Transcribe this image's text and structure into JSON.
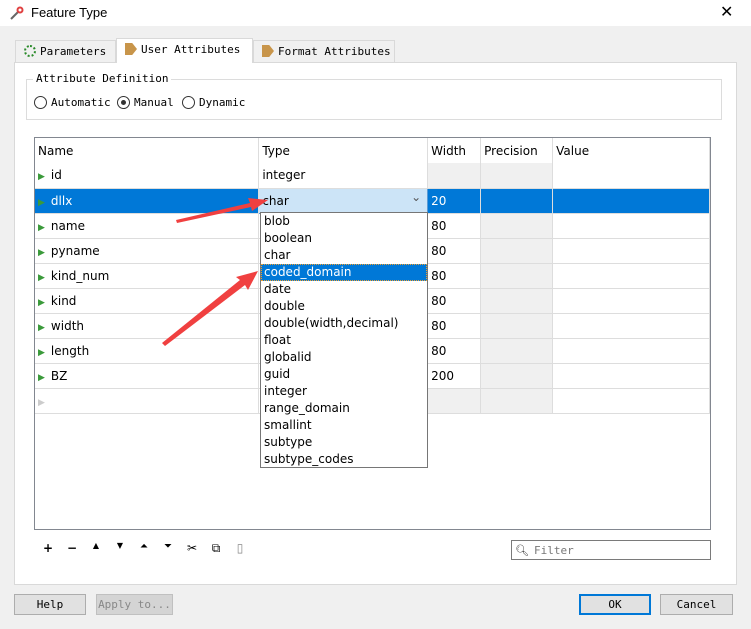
{
  "window": {
    "title": "Feature Type",
    "close": "✕"
  },
  "tabs": [
    {
      "label": "Parameters",
      "icon": "gear-icon"
    },
    {
      "label": "User Attributes",
      "icon": "arrow-tag-icon",
      "active": true
    },
    {
      "label": "Format Attributes",
      "icon": "arrow-tag-icon"
    }
  ],
  "attribute_definition": {
    "label": "Attribute Definition",
    "options": [
      "Automatic",
      "Manual",
      "Dynamic"
    ],
    "selected": "Manual"
  },
  "table": {
    "columns": [
      "Name",
      "Type",
      "Width",
      "Precision",
      "Value"
    ],
    "rows": [
      {
        "name": "id",
        "type": "integer",
        "width": ""
      },
      {
        "name": "dllx",
        "type": "char",
        "width": "20",
        "selected": true
      },
      {
        "name": "name",
        "type": "",
        "width": "80"
      },
      {
        "name": "pyname",
        "type": "",
        "width": "80"
      },
      {
        "name": "kind_num",
        "type": "",
        "width": "80"
      },
      {
        "name": "kind",
        "type": "",
        "width": "80"
      },
      {
        "name": "width",
        "type": "",
        "width": "80"
      },
      {
        "name": "length",
        "type": "",
        "width": "80"
      },
      {
        "name": "BZ",
        "type": "",
        "width": "200"
      }
    ]
  },
  "dropdown": {
    "options": [
      "blob",
      "boolean",
      "char",
      "coded_domain",
      "date",
      "double",
      "double(width,decimal)",
      "float",
      "globalid",
      "guid",
      "integer",
      "range_domain",
      "smallint",
      "subtype",
      "subtype_codes"
    ],
    "highlighted": "coded_domain"
  },
  "toolbar": {
    "add": "+",
    "remove": "−",
    "up": "▲",
    "down": "▼",
    "top": "⏶",
    "bottom": "⏷",
    "cut": "✂",
    "copy": "⧉",
    "paste": "▯"
  },
  "filter": {
    "placeholder": "Filter"
  },
  "buttons": {
    "help": "Help",
    "apply": "Apply to...",
    "ok": "OK",
    "cancel": "Cancel"
  },
  "colors": {
    "selection": "#0078d7",
    "annotation_arrow": "#f04040"
  }
}
